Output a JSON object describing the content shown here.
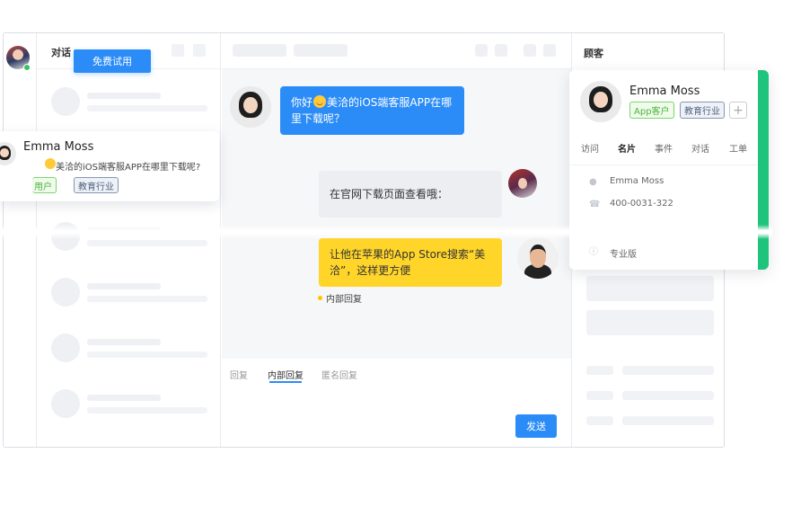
{
  "sidebar": {
    "conversations_title": "对话"
  },
  "trial_button": {
    "label": "免费试用"
  },
  "chat": {
    "messages": [
      {
        "from": "customer",
        "text_before": "你好",
        "text_after": "美洽的iOS端客服APP在哪里下载呢？"
      },
      {
        "from": "agent",
        "text": "在官网下载页面查看哦："
      },
      {
        "from": "agent_internal",
        "text": "让他在苹果的App Store搜索“美洽”，这样更方便"
      }
    ],
    "internal_note": "内部回复",
    "compose_tabs": [
      "回复",
      "内部回复",
      "匿名回复"
    ],
    "active_compose_tab": "内部回复",
    "send_label": "发送"
  },
  "customer_panel": {
    "title": "顾客",
    "name": "Emma Moss",
    "tags": [
      "App客户",
      "教育行业"
    ],
    "add_tag": "+",
    "tabs": [
      "访问",
      "名片",
      "事件",
      "对话",
      "工单"
    ],
    "active_tab": "名片",
    "fields": {
      "name": "Emma Moss",
      "phone": "400-0031-322",
      "plan": "专业版"
    }
  },
  "preview_card": {
    "name": "Emma Moss",
    "message": "美洽的iOS端客服APP在哪里下载呢?",
    "tags": [
      "用户",
      "教育行业"
    ],
    "tag_visible_fragment": "用户"
  },
  "colors": {
    "accent": "#2b8cf7",
    "internal": "#ffd52a",
    "success": "#1fc47c"
  }
}
